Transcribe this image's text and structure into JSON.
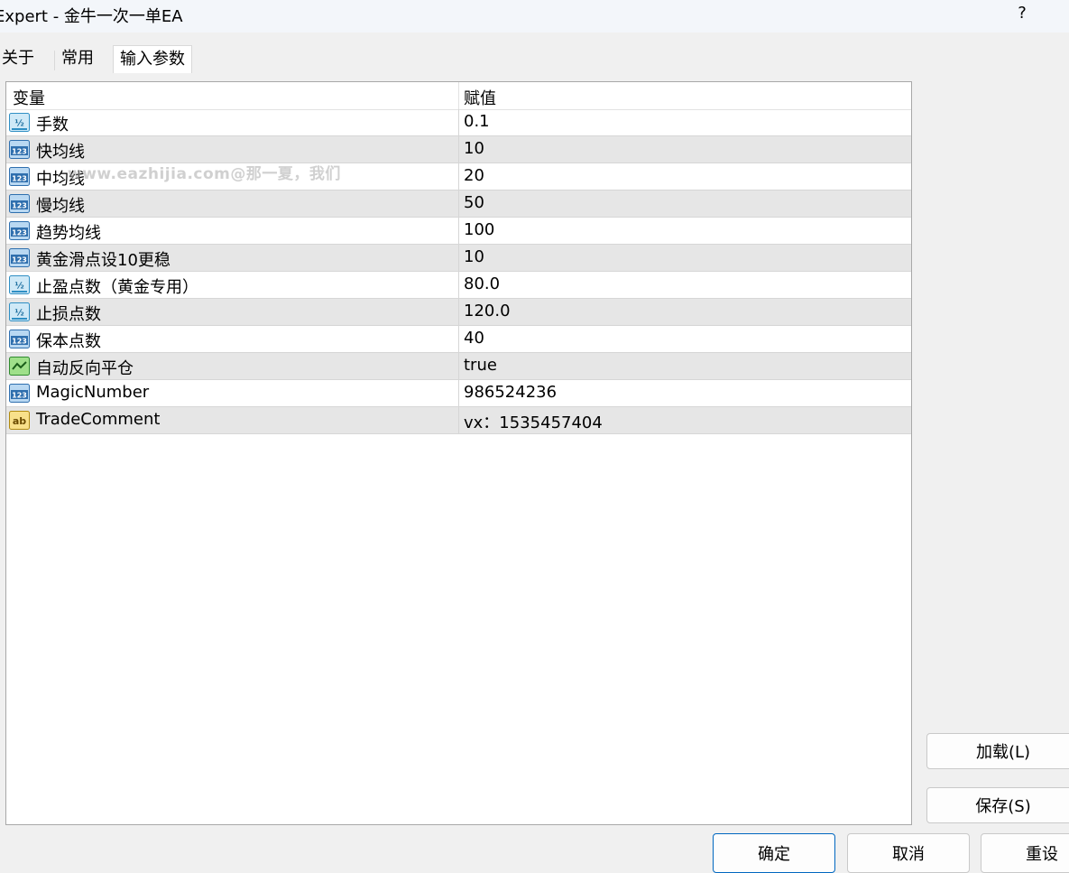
{
  "window": {
    "title": "Expert - 金牛一次一单EA",
    "help": "?"
  },
  "tabs": [
    "关于",
    "常用",
    "输入参数"
  ],
  "grid": {
    "headers": {
      "variable": "变量",
      "value": "赋值"
    },
    "rows": [
      {
        "name": "手数",
        "value": "0.1",
        "icon": "double-icon"
      },
      {
        "name": "快均线",
        "value": "10",
        "icon": "integer-icon"
      },
      {
        "name": "中均线",
        "value": "20",
        "icon": "integer-icon"
      },
      {
        "name": "慢均线",
        "value": "50",
        "icon": "integer-icon"
      },
      {
        "name": "趋势均线",
        "value": "100",
        "icon": "integer-icon"
      },
      {
        "name": "黄金滑点设10更稳",
        "value": "10",
        "icon": "integer-icon"
      },
      {
        "name": "止盈点数（黄金专用）",
        "value": "80.0",
        "icon": "double-icon"
      },
      {
        "name": "止损点数",
        "value": "120.0",
        "icon": "double-icon"
      },
      {
        "name": "保本点数",
        "value": "40",
        "icon": "integer-icon"
      },
      {
        "name": "自动反向平仓",
        "value": "true",
        "icon": "bool-icon"
      },
      {
        "name": "MagicNumber",
        "value": "986524236",
        "icon": "integer-icon"
      },
      {
        "name": "TradeComment",
        "value": "vx：1535457404",
        "icon": "string-icon"
      }
    ]
  },
  "watermark": "www.eazhijia.com@那一夏，我们",
  "buttons": {
    "load": "加载(L)",
    "save": "保存(S)",
    "ok": "确定",
    "cancel": "取消",
    "reset": "重设"
  },
  "colors": {
    "primary_border": "#0067c0",
    "alt_row": "#e6e6e6"
  }
}
